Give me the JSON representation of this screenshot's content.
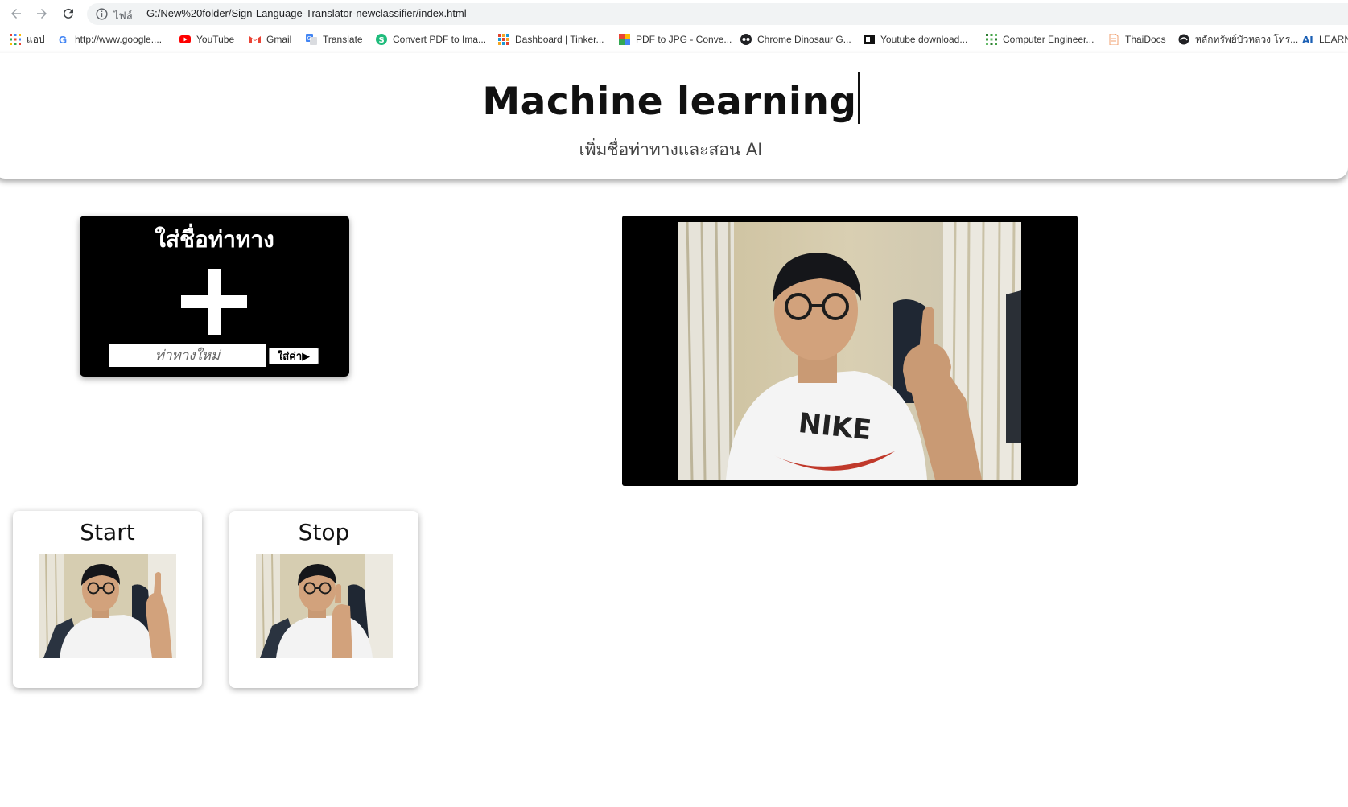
{
  "browser": {
    "scheme_label": "ไฟล์",
    "url": "G:/New%20folder/Sign-Language-Translator-newclassifier/index.html",
    "bookmarks": [
      {
        "label": "แอป",
        "icon": "apps-grid-icon"
      },
      {
        "label": "http://www.google....",
        "icon": "google-icon"
      },
      {
        "label": "YouTube",
        "icon": "youtube-icon"
      },
      {
        "label": "Gmail",
        "icon": "gmail-icon"
      },
      {
        "label": "Translate",
        "icon": "translate-icon"
      },
      {
        "label": "Convert PDF to Ima...",
        "icon": "pdf-convert-icon"
      },
      {
        "label": "Dashboard | Tinker...",
        "icon": "tinkercad-icon"
      },
      {
        "label": "PDF to JPG - Conve...",
        "icon": "pdf-jpg-icon"
      },
      {
        "label": "Chrome Dinosaur G...",
        "icon": "dinosaur-game-icon"
      },
      {
        "label": "Youtube download...",
        "icon": "youtube-download-icon"
      },
      {
        "label": "Computer Engineer...",
        "icon": "computer-engineer-icon"
      },
      {
        "label": "ThaiDocs",
        "icon": "thaidocs-icon"
      },
      {
        "label": "หลักทรัพย์บัวหลวง โทร...",
        "icon": "bualuang-icon"
      },
      {
        "label": "LEARN",
        "icon": "ai-learn-icon"
      }
    ]
  },
  "header": {
    "title": "Machine learning",
    "subtitle": "เพิ่มชื่อท่าทางและสอน AI"
  },
  "add_class": {
    "title": "ใส่ชื่อท่าทาง",
    "input_placeholder": "ท่าทางใหม่",
    "input_value": "",
    "button_label": "ใส่ค่า▶"
  },
  "classes": [
    {
      "label": "Start"
    },
    {
      "label": "Stop"
    }
  ],
  "colors": {
    "page_bg": "#ffffff",
    "card_dark": "#000000",
    "text": "#111111"
  }
}
